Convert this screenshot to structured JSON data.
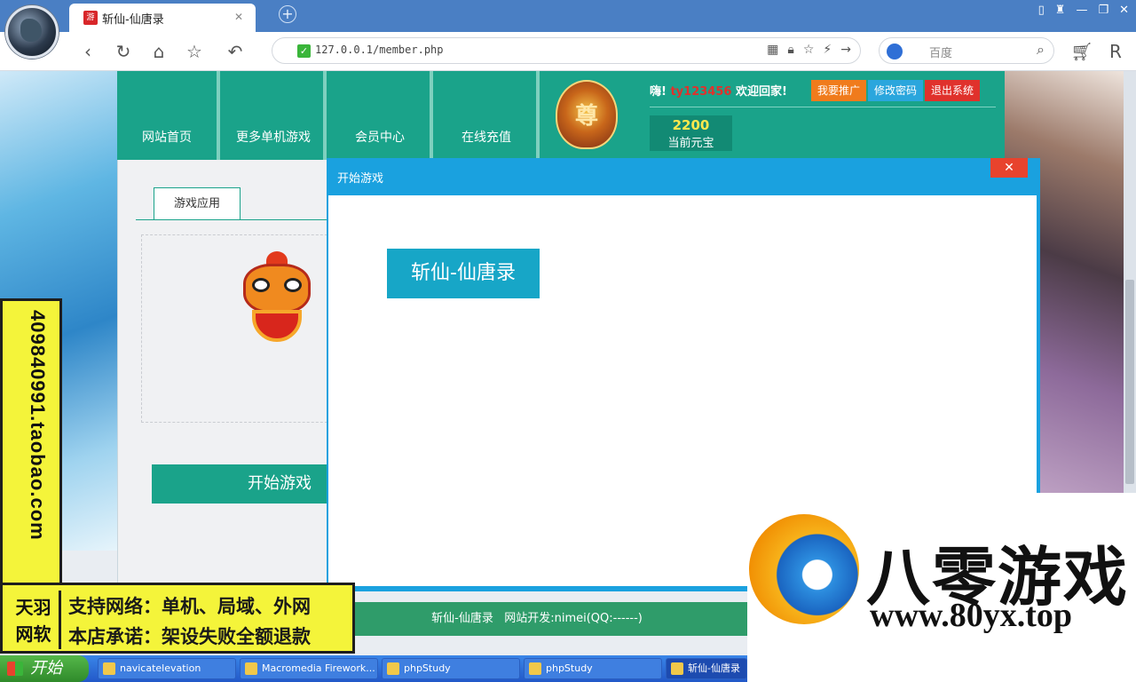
{
  "browser": {
    "tab_title": "斩仙-仙唐录",
    "tab_favicon": "游戏",
    "url": "127.0.0.1/member.php",
    "search_placeholder": "百度",
    "window_controls": [
      "▯",
      "♜",
      "—",
      "❐",
      "✕"
    ]
  },
  "header": {
    "nav": [
      "网站首页",
      "更多单机游戏",
      "会员中心",
      "在线充值"
    ],
    "badge_text": "尊",
    "greeting_prefix": "嗨!",
    "username": "ty123456",
    "greeting_suffix": "欢迎回家!",
    "buttons": [
      {
        "label": "我要推广",
        "color": "#f07b1c"
      },
      {
        "label": "修改密码",
        "color": "#2aa6dd"
      },
      {
        "label": "退出系统",
        "color": "#e0312c"
      }
    ],
    "coins_value": "2200",
    "coins_label": "当前元宝"
  },
  "panel": {
    "tab_label": "游戏应用",
    "start_button": "开始游戏"
  },
  "modal": {
    "title": "开始游戏",
    "close": "✕",
    "game_button": "斩仙-仙唐录"
  },
  "footer": {
    "text": "斩仙-仙唐录   网站开发:nimei(QQ:------)"
  },
  "ads": {
    "vertical_text": "409840991.taobao.com",
    "logo_text": "天羽网软",
    "line1": "支持网络：单机、局域、外网",
    "line2": "本店承诺：架设失败全额退款"
  },
  "brand": {
    "name": "八零游戏",
    "url": "www.80yx.top"
  },
  "taskbar": {
    "start": "开始",
    "tasks": [
      "navicatelevation",
      "Macromedia Firework...",
      "phpStudy",
      "phpStudy",
      "斩仙-仙唐录"
    ]
  }
}
